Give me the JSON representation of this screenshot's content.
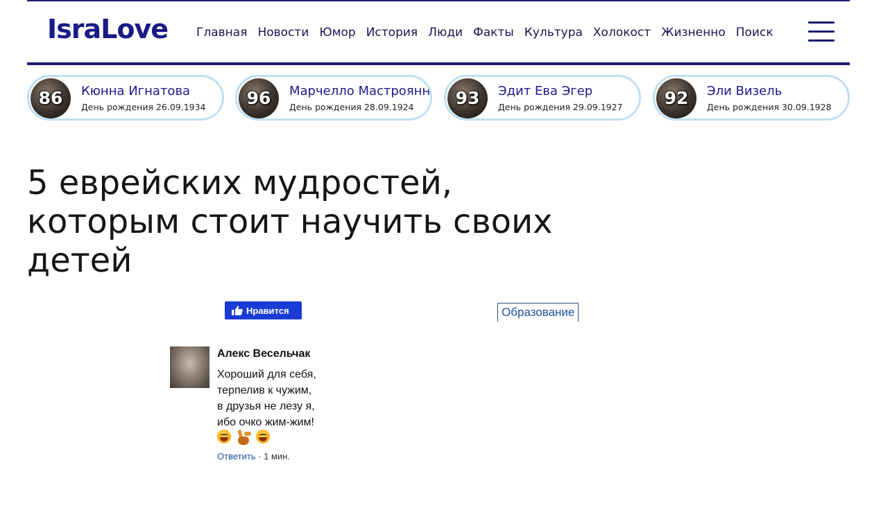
{
  "site": {
    "logo": "IsraLove",
    "nav": [
      "Главная",
      "Новости",
      "Юмор",
      "История",
      "Люди",
      "Факты",
      "Культура",
      "Холокост",
      "Жизненно",
      "Поиск"
    ]
  },
  "birthdays": [
    {
      "age": "86",
      "name": "Кюнна Игнатова",
      "date": "День рождения 26.09.1934"
    },
    {
      "age": "96",
      "name": "Марчелло Мастроянни",
      "date": "День рождения 28.09.1924"
    },
    {
      "age": "93",
      "name": "Эдит Ева Эгер",
      "date": "День рождения 29.09.1927"
    },
    {
      "age": "92",
      "name": "Эли Визель",
      "date": "День рождения 30.09.1928"
    }
  ],
  "article": {
    "title": "5 еврейских мудростей, которым стоит научить своих детей",
    "like_label": "Нравится",
    "tag": "Образование"
  },
  "comment": {
    "author": "Алекс Весельчак",
    "text": "Хороший для себя,\nтерпелив к чужим,\nв друзья не лезу я,\nибо очко жим-жим!",
    "reply_label": "Ответить",
    "separator": " · ",
    "time": "1 мин."
  },
  "colors": {
    "brand": "#1a1a86",
    "accent_line": "#1c1c6e",
    "bubble_border": "#bfe0f2",
    "like_button": "#1a3bd6",
    "link": "#1d4f9c"
  }
}
